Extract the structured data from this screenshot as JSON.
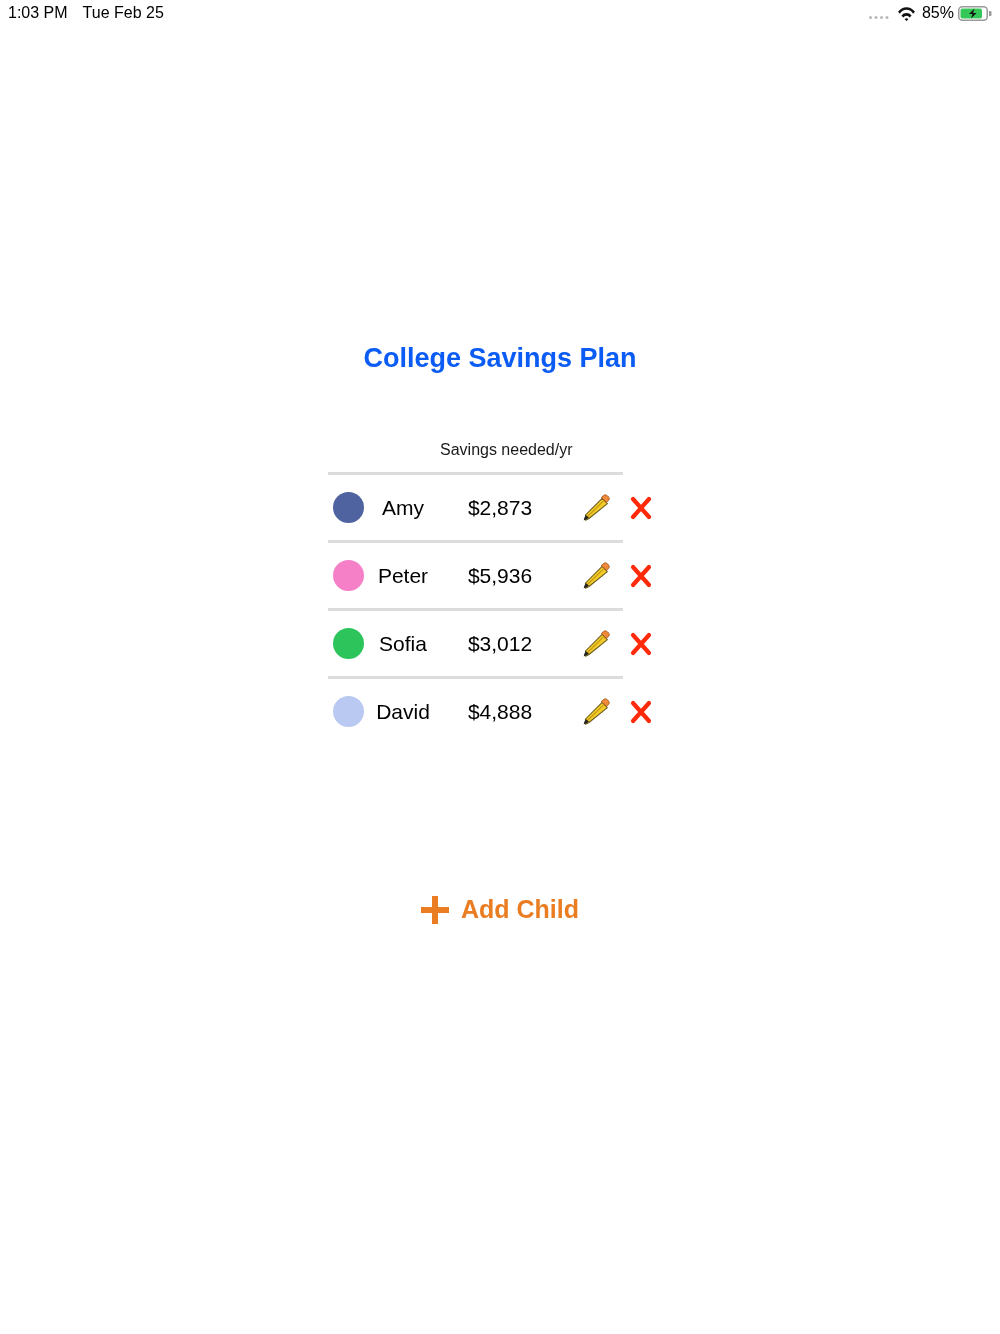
{
  "status_bar": {
    "time": "1:03 PM",
    "date": "Tue Feb 25",
    "battery": "85%"
  },
  "title": "College Savings Plan",
  "table": {
    "column_header": "Savings needed/yr",
    "rows": [
      {
        "name": "Amy",
        "amount": "$2,873",
        "color": "#4f63a0"
      },
      {
        "name": "Peter",
        "amount": "$5,936",
        "color": "#f580c8"
      },
      {
        "name": "Sofia",
        "amount": "$3,012",
        "color": "#2dc55b"
      },
      {
        "name": "David",
        "amount": "$4,888",
        "color": "#b9c9f1"
      }
    ]
  },
  "add_button": {
    "label": "Add Child"
  }
}
